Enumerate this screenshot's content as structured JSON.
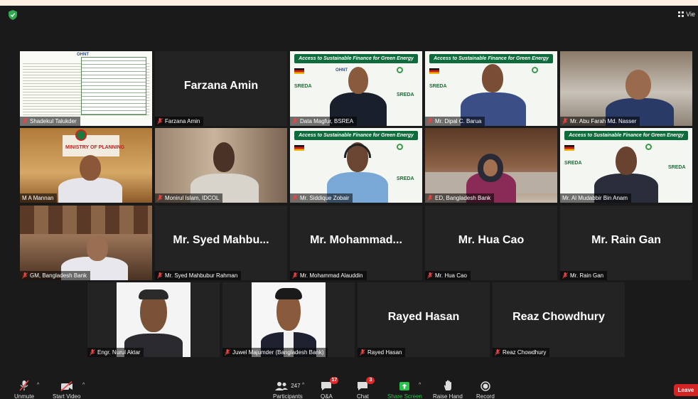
{
  "window": {
    "view_label": "Vie"
  },
  "participants": [
    {
      "display_name": "Shadekul Talukder",
      "muted": true,
      "video": "document"
    },
    {
      "display_name": "Farzana Amin",
      "muted": true,
      "video": "off",
      "big_name": "Farzana Amin"
    },
    {
      "display_name": "Data Magfur, BSREA",
      "muted": true,
      "video": "banner"
    },
    {
      "display_name": "Mr. Dipal C. Barua",
      "muted": true,
      "video": "banner"
    },
    {
      "display_name": "Mr. Abu Farah Md. Nasser",
      "muted": true,
      "video": "camera"
    },
    {
      "display_name": "M A Mannan",
      "muted": false,
      "video": "camera"
    },
    {
      "display_name": "Monirul Islam, IDCOL",
      "muted": true,
      "video": "camera"
    },
    {
      "display_name": "Mr. Siddique Zobair",
      "muted": true,
      "video": "banner"
    },
    {
      "display_name": "ED, Bangladesh Bank",
      "muted": true,
      "video": "camera"
    },
    {
      "display_name": "Mr. Al Mudabbir Bin Anam",
      "muted": false,
      "video": "banner",
      "active_speaker": true
    },
    {
      "display_name": "GM, Bangladesh Bank",
      "muted": true,
      "video": "camera"
    },
    {
      "display_name": "Mr. Syed Mahbubur Rahman",
      "muted": true,
      "video": "off",
      "big_name": "Mr. Syed Mahbu..."
    },
    {
      "display_name": "Mr. Mohammad Alauddin",
      "muted": true,
      "video": "off",
      "big_name": "Mr. Mohammad..."
    },
    {
      "display_name": "Mr. Hua Cao",
      "muted": true,
      "video": "off",
      "big_name": "Mr. Hua Cao"
    },
    {
      "display_name": "Mr. Rain Gan",
      "muted": true,
      "video": "off",
      "big_name": "Mr. Rain Gan"
    },
    {
      "display_name": "Engr. Nurul Aktar",
      "muted": true,
      "video": "photo"
    },
    {
      "display_name": "Juwel Majumder (Bangladesh Bank)",
      "muted": true,
      "video": "photo"
    },
    {
      "display_name": "Rayed Hasan",
      "muted": true,
      "video": "off",
      "big_name": "Rayed Hasan"
    },
    {
      "display_name": "Reaz Chowdhury",
      "muted": true,
      "video": "off",
      "big_name": "Reaz Chowdhury"
    }
  ],
  "banner": {
    "title": "Access to Sustainable Finance for Green Energy",
    "logos": [
      "SREDA",
      "OHNT",
      "IDCOL"
    ]
  },
  "placard": {
    "ministry_text": "MINISTRY OF PLANNING"
  },
  "toolbar": {
    "unmute_label": "Unmute",
    "start_video_label": "Start Video",
    "participants_label": "Participants",
    "participants_count": "247",
    "qa_label": "Q&A",
    "qa_badge": "17",
    "chat_label": "Chat",
    "chat_badge": "3",
    "share_label": "Share Screen",
    "raise_hand_label": "Raise Hand",
    "record_label": "Record",
    "leave_label": "Leave"
  },
  "colors": {
    "banner_green": "#0f6b3c",
    "active_speaker_border": "#e8dc6a",
    "share_green": "#29c24a",
    "leave_red": "#d42424",
    "badge_red": "#e02828"
  }
}
